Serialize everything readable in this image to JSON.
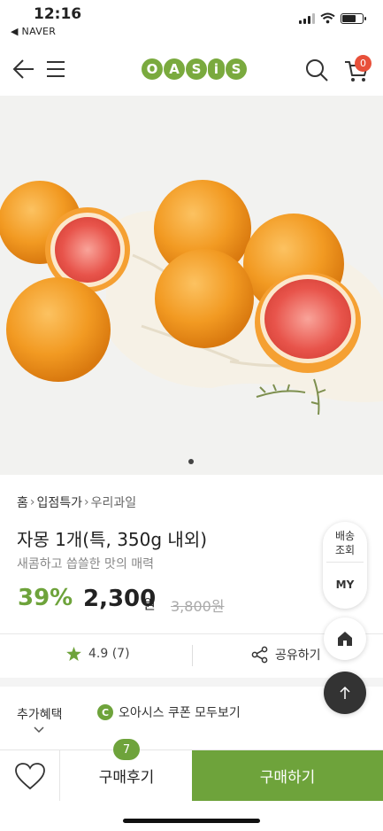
{
  "status_bar": {
    "time": "12:16",
    "back_app": "◀ NAVER"
  },
  "header": {
    "logo_letters": [
      "O",
      "A",
      "S",
      "i",
      "S"
    ],
    "cart_count": "0"
  },
  "hero": {
    "image_alt": "grapefruit photo",
    "page_indicator_count": 1
  },
  "breadcrumb": [
    "홈",
    "입점특가",
    "우리과일"
  ],
  "product": {
    "title": "자몽 1개(특, 350g 내외)",
    "subtitle": "새콤하고 씁쓸한 맛의 매력",
    "discount": "39%",
    "price": "2,300",
    "price_unit": "원",
    "original_price": "3,800원"
  },
  "rating": {
    "score": "4.9 (7)"
  },
  "share_label": "공유하기",
  "benefit": {
    "label": "추가혜택",
    "coupon_icon": "C",
    "coupon_text": "오아시스 쿠폰 모두보기"
  },
  "floating": {
    "track_label": "배송\n조회",
    "my_label": "MY"
  },
  "bottom_bar": {
    "review_label": "구매후기",
    "review_count": "7",
    "buy_label": "구매하기"
  },
  "colors": {
    "brand": "#6ea33b",
    "badge": "#e8503a"
  }
}
